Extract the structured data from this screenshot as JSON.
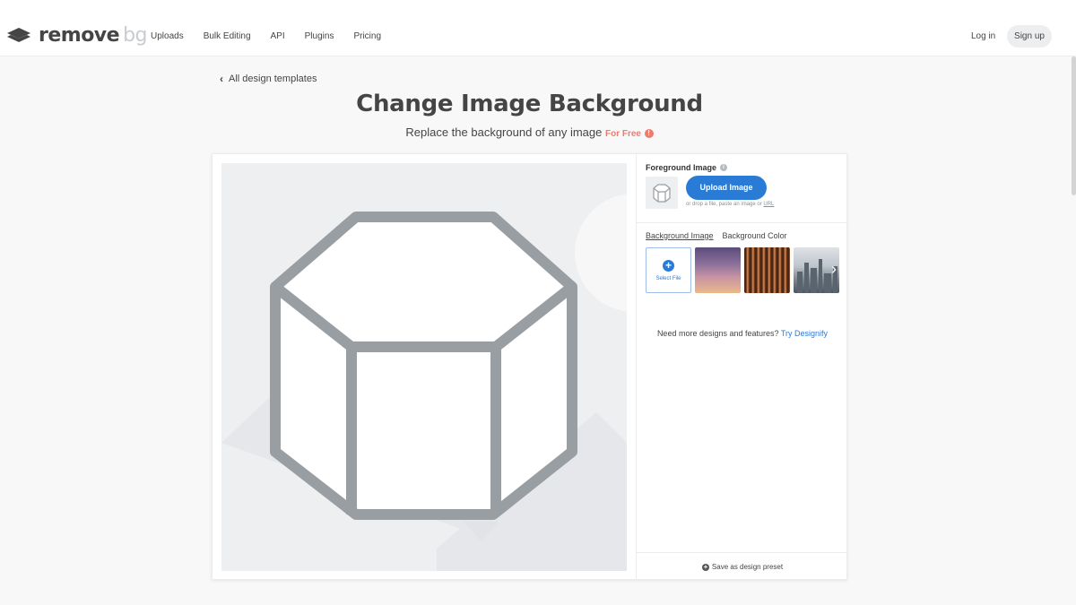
{
  "header": {
    "logo_main": "remove",
    "logo_accent": "bg",
    "nav": [
      "Uploads",
      "Bulk Editing",
      "API",
      "Plugins",
      "Pricing"
    ],
    "login": "Log in",
    "signup": "Sign up"
  },
  "page": {
    "back_link": "All design templates",
    "title": "Change Image Background",
    "subtitle": "Replace the background of any image",
    "subtitle_badge": "For Free"
  },
  "panel": {
    "foreground_label": "Foreground Image",
    "upload_button": "Upload Image",
    "drop_hint_prefix": "or drop a file, paste an image or ",
    "drop_hint_link": "URL",
    "tabs": [
      "Background Image",
      "Background Color"
    ],
    "active_tab": "Background Image",
    "select_file": "Select File",
    "backgrounds": [
      "purple-sunset",
      "copper-stripes",
      "city-skyline"
    ],
    "promo_text": "Need more designs and features? ",
    "promo_link": "Try Designify",
    "save_preset": "Save as design preset"
  },
  "colors": {
    "brand_blue": "#2a7bd6",
    "free_red": "#ee7b6d",
    "text": "#454545",
    "placeholder_gray": "#999ea3"
  }
}
